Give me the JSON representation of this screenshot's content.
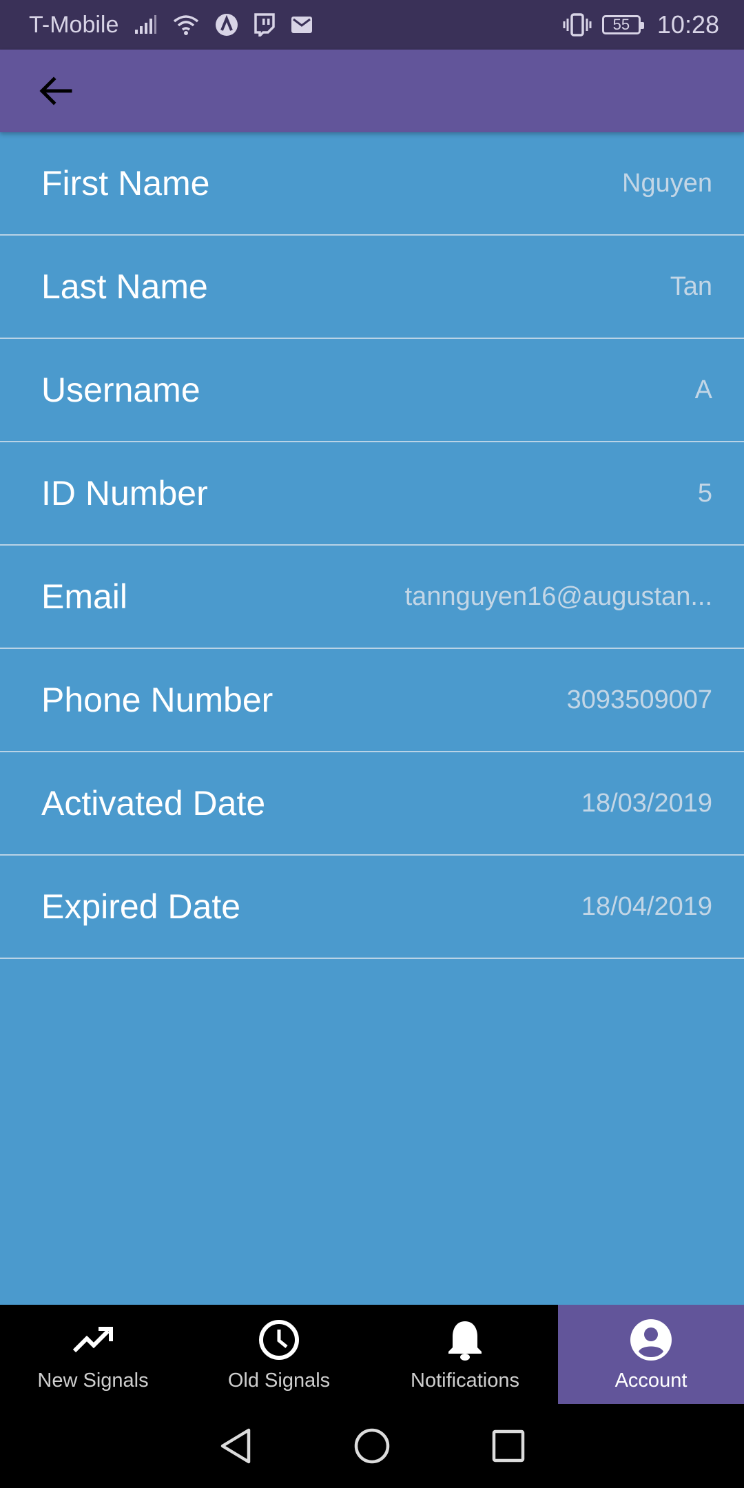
{
  "status_bar": {
    "carrier": "T-Mobile",
    "battery": "55",
    "time": "10:28",
    "icons": [
      "signal-icon",
      "wifi-icon",
      "app-a-icon",
      "twitch-icon",
      "mail-icon",
      "vibrate-icon",
      "battery-icon"
    ]
  },
  "app_bar": {
    "back_icon": "arrow-back-icon"
  },
  "account": {
    "rows": [
      {
        "label": "First Name",
        "value": "Nguyen"
      },
      {
        "label": "Last Name",
        "value": "Tan"
      },
      {
        "label": "Username",
        "value": "A"
      },
      {
        "label": "ID Number",
        "value": "5"
      },
      {
        "label": "Email",
        "value": "tannguyen16@augustan..."
      },
      {
        "label": "Phone Number",
        "value": "3093509007"
      },
      {
        "label": "Activated Date",
        "value": "18/03/2019"
      },
      {
        "label": "Expired Date",
        "value": "18/04/2019"
      }
    ]
  },
  "bottom_nav": {
    "items": [
      {
        "label": "New Signals",
        "icon": "trending-up-icon",
        "active": false
      },
      {
        "label": "Old Signals",
        "icon": "clock-icon",
        "active": false
      },
      {
        "label": "Notifications",
        "icon": "bell-icon",
        "active": false
      },
      {
        "label": "Account",
        "icon": "account-circle-icon",
        "active": true
      }
    ]
  },
  "colors": {
    "status_bar": "#3a3158",
    "app_bar": "#62559a",
    "background": "#4b9acd",
    "divider": "#b9d3e6",
    "nav_background": "#000000",
    "nav_active": "#62559a"
  }
}
